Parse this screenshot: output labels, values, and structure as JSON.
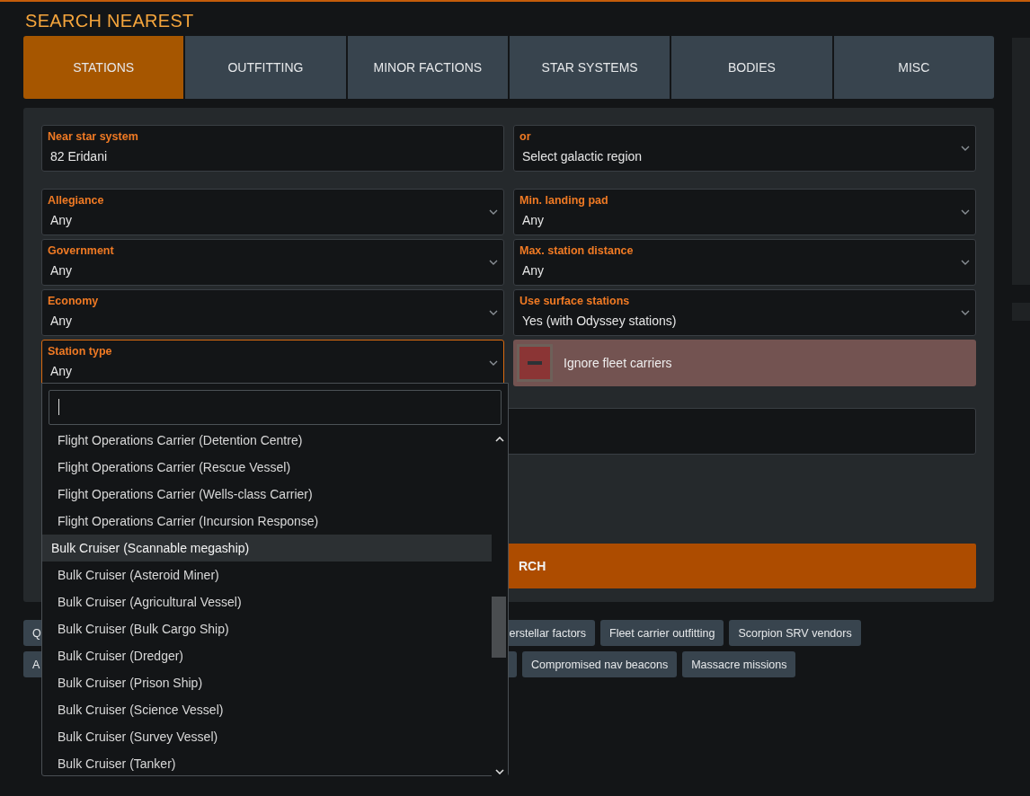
{
  "title": "SEARCH NEAREST",
  "tabs": [
    {
      "label": "STATIONS",
      "selected": true
    },
    {
      "label": "OUTFITTING",
      "selected": false
    },
    {
      "label": "MINOR FACTIONS",
      "selected": false
    },
    {
      "label": "STAR SYSTEMS",
      "selected": false
    },
    {
      "label": "BODIES",
      "selected": false
    },
    {
      "label": "MISC",
      "selected": false
    }
  ],
  "location": [
    {
      "kind": "text",
      "label": "Near star system",
      "value": "82 Eridani",
      "focused": false
    },
    {
      "kind": "select",
      "label": "or",
      "value": "Select galactic region",
      "focused": false
    }
  ],
  "filters": [
    {
      "kind": "select",
      "label": "Allegiance",
      "value": "Any",
      "focused": false
    },
    {
      "kind": "select",
      "label": "Min. landing pad",
      "value": "Any",
      "focused": false
    },
    {
      "kind": "select",
      "label": "Government",
      "value": "Any",
      "focused": false
    },
    {
      "kind": "select",
      "label": "Max. station distance",
      "value": "Any",
      "focused": false
    },
    {
      "kind": "select",
      "label": "Economy",
      "value": "Any",
      "focused": false
    },
    {
      "kind": "select",
      "label": "Use surface stations",
      "value": "Yes (with Odyssey stations)",
      "focused": false
    },
    {
      "kind": "select",
      "label": "Station type",
      "value": "Any",
      "focused": true
    },
    {
      "kind": "toggle",
      "label": "Ignore fleet carriers",
      "on": true
    }
  ],
  "search_button": "RCH",
  "chips": [
    [
      "Q",
      "erstellar factors",
      "Fleet carrier outfitting",
      "Scorpion SRV vendors"
    ],
    [
      "A",
      "Compromised nav beacons",
      "Massacre missions"
    ]
  ],
  "dropdown": {
    "options": [
      {
        "label": "Flight Operations Carrier (Detention Centre)",
        "selected": false
      },
      {
        "label": "Flight Operations Carrier (Rescue Vessel)",
        "selected": false
      },
      {
        "label": "Flight Operations Carrier (Wells-class Carrier)",
        "selected": false
      },
      {
        "label": "Flight Operations Carrier (Incursion Response)",
        "selected": false
      },
      {
        "label": "Bulk Cruiser (Scannable megaship)",
        "selected": true
      },
      {
        "label": "Bulk Cruiser (Asteroid Miner)",
        "selected": false
      },
      {
        "label": "Bulk Cruiser (Agricultural Vessel)",
        "selected": false
      },
      {
        "label": "Bulk Cruiser (Bulk Cargo Ship)",
        "selected": false
      },
      {
        "label": "Bulk Cruiser (Dredger)",
        "selected": false
      },
      {
        "label": "Bulk Cruiser (Prison Ship)",
        "selected": false
      },
      {
        "label": "Bulk Cruiser (Science Vessel)",
        "selected": false
      },
      {
        "label": "Bulk Cruiser (Survey Vessel)",
        "selected": false
      },
      {
        "label": "Bulk Cruiser (Tanker)",
        "selected": false
      }
    ]
  }
}
